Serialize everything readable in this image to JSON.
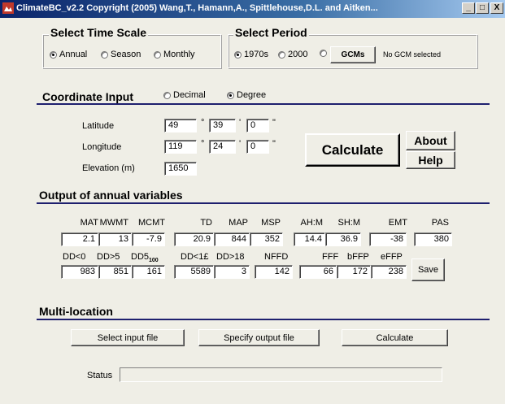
{
  "window": {
    "title": "ClimateBC_v2.2 Copyright (2005) Wang,T., Hamann,A., Spittlehouse,D.L. and Aitken...",
    "minimize": "_",
    "maximize": "□",
    "close": "X"
  },
  "time_scale": {
    "title": "Select Time Scale",
    "options": [
      "Annual",
      "Season",
      "Monthly"
    ],
    "selected": "Annual"
  },
  "period": {
    "title": "Select Period",
    "options": [
      "1970s",
      "2000",
      ""
    ],
    "selected": "1970s",
    "gcm_button": "GCMs",
    "gcm_status": "No GCM selected"
  },
  "coordinate": {
    "title": "Coordinate Input",
    "formats": [
      "Decimal",
      "Degree"
    ],
    "selected": "Degree",
    "latitude_label": "Latitude",
    "longitude_label": "Longitude",
    "elevation_label": "Elevation (m)",
    "deg_symbol": "°",
    "min_symbol": "'",
    "sec_symbol": "\"",
    "latitude": {
      "deg": "49",
      "min": "39",
      "sec": "0"
    },
    "longitude": {
      "deg": "119",
      "min": "24",
      "sec": "0"
    },
    "elevation": "1650"
  },
  "buttons": {
    "calculate": "Calculate",
    "about": "About",
    "help": "Help",
    "save": "Save"
  },
  "output": {
    "title": "Output of annual variables",
    "row1_headers": [
      "MAT",
      "MWMT",
      "MCMT",
      "TD",
      "MAP",
      "MSP",
      "AH:M",
      "SH:M",
      "EMT",
      "PAS"
    ],
    "row1_values": [
      "2.1",
      "13",
      "-7.9",
      "20.9",
      "844",
      "352",
      "14.4",
      "36.9",
      "-38",
      "380"
    ],
    "row2_headers": [
      "DD<0",
      "DD>5",
      "DD5_100",
      "DD<18",
      "DD>18",
      "NFFD",
      "FFF",
      "bFFP",
      "eFFP"
    ],
    "row2_header_display": [
      "DD<0",
      "DD>5",
      "DD5",
      "DD<1£",
      "DD>18",
      "NFFD",
      "FFF",
      "bFFP",
      "eFFP"
    ],
    "dd5_subscript": "100",
    "row2_values": [
      "983",
      "851",
      "161",
      "5589",
      "3",
      "142",
      "66",
      "172",
      "238"
    ]
  },
  "multi": {
    "title": "Multi-location",
    "select_input": "Select input file",
    "specify_output": "Specify output file",
    "calculate": "Calculate",
    "status_label": "Status",
    "status_value": ""
  }
}
